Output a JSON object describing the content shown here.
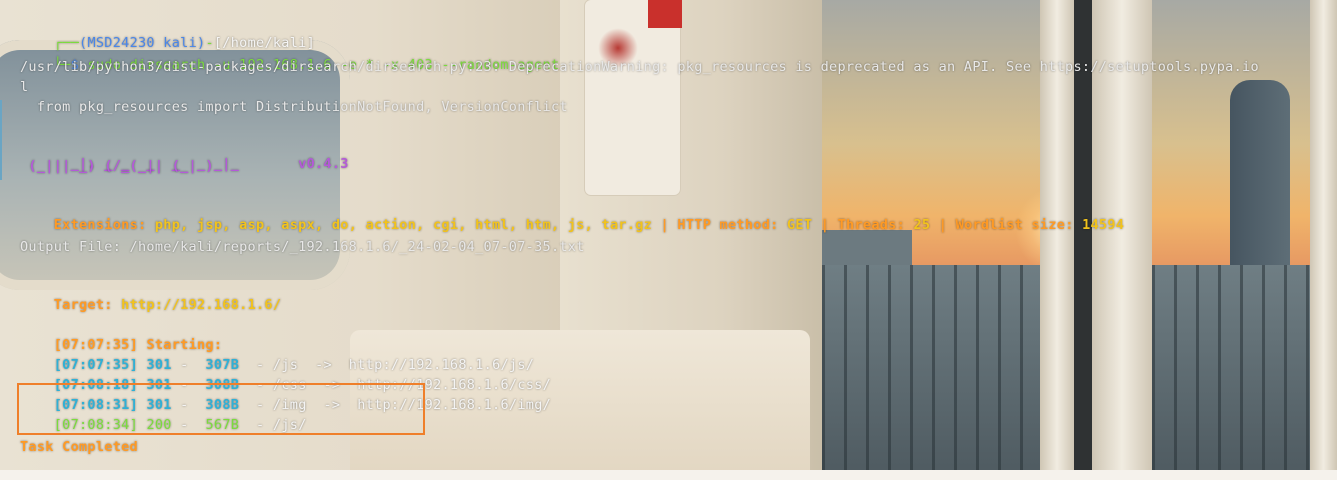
{
  "prompt": {
    "corner_top": "┌──",
    "user_host": "(MSD24230 kali)",
    "dash": "-",
    "path": "[/home/kali]",
    "corner_bottom": "└─",
    "symbol": "$",
    "command": "sudo dirsearch -u 192.168.1.6 -e * -x 403 --random-agent"
  },
  "warning": {
    "line1": "/usr/lib/python3/dist-packages/dirsearch/dirsearch.py:23: DeprecationWarning: pkg_resources is deprecated as an API. See https://setuptools.pypa.io",
    "line2": "l",
    "line3": "  from pkg_resources import DistributionNotFound, VersionConflict"
  },
  "banner": {
    "art1": "  _|. _ _  _  _  _ _|_",
    "version": "v0.4.3",
    "art2": " (_||| _) (/_(_|| (_| )"
  },
  "info": {
    "extensions_label": "Extensions:",
    "extensions_value": "php, jsp, asp, aspx, do, action, cgi, html, htm, js, tar.gz",
    "sep1": "|",
    "method_label": "HTTP method:",
    "method_value": "GET",
    "sep2": "|",
    "threads_label": "Threads:",
    "threads_value": "25",
    "sep3": "|",
    "wordlist_label": "Wordlist size:",
    "wordlist_value": "14594",
    "output": "Output File: /home/kali/reports/_192.168.1.6/_24-02-04_07-07-35.txt",
    "target_label": "Target:",
    "target_value": "http://192.168.1.6/"
  },
  "scan": {
    "start_time": "[07:07:35]",
    "start_label": "Starting:",
    "results": [
      {
        "time": "[07:07:35]",
        "status": "301",
        "size": "307B",
        "path": "/js",
        "arrow": "->",
        "redirect": "http://192.168.1.6/js/"
      },
      {
        "time": "[07:08:18]",
        "status": "301",
        "size": "308B",
        "path": "/css",
        "arrow": "->",
        "redirect": "http://192.168.1.6/css/"
      },
      {
        "time": "[07:08:31]",
        "status": "301",
        "size": "308B",
        "path": "/img",
        "arrow": "->",
        "redirect": "http://192.168.1.6/img/"
      },
      {
        "time": "[07:08:34]",
        "status": "200",
        "size": "567B",
        "path": "/js/",
        "arrow": "",
        "redirect": ""
      }
    ],
    "separator": "-",
    "completed": "Task Completed"
  },
  "colors": {
    "highlight_border": "#ef7f2a",
    "prompt_green": "#7bdc3c",
    "info_yellow": "#f2c31c",
    "banner_purple": "#b45ad8"
  }
}
